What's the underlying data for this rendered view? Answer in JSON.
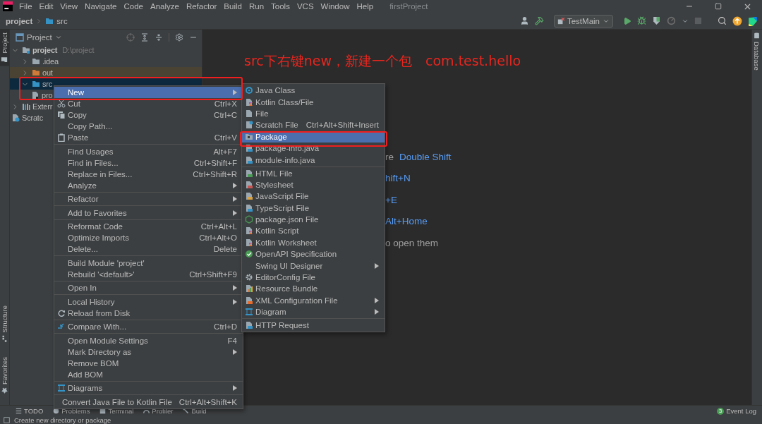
{
  "menu_bar": {
    "items": [
      "File",
      "Edit",
      "View",
      "Navigate",
      "Code",
      "Analyze",
      "Refactor",
      "Build",
      "Run",
      "Tools",
      "VCS",
      "Window",
      "Help"
    ],
    "project_title": "firstProject"
  },
  "breadcrumbs": [
    "project",
    "src"
  ],
  "run_config": {
    "label": "TestMain"
  },
  "left_strip": [
    {
      "label": "Project",
      "selected": true
    },
    {
      "label": "Structure",
      "selected": false
    },
    {
      "label": "Favorites",
      "selected": false
    }
  ],
  "right_strip": [
    {
      "label": "Database",
      "selected": false
    }
  ],
  "project_panel": {
    "title": "Project",
    "tree": [
      {
        "label": "project",
        "path": "D:\\project",
        "kind": "module",
        "expanded": true,
        "selected": false,
        "children": [
          {
            "label": ".idea",
            "kind": "folder",
            "expanded": false,
            "selected": false
          },
          {
            "label": "out",
            "kind": "excluded-folder",
            "expanded": false,
            "selected": false
          },
          {
            "label": "src",
            "kind": "source-folder",
            "expanded": true,
            "selected": true,
            "children": [
              {
                "label": "pro",
                "kind": "file",
                "selected": false
              }
            ]
          }
        ]
      },
      {
        "label": "Exterr",
        "kind": "libraries",
        "expanded": false,
        "selected": false
      },
      {
        "label": "Scratc",
        "kind": "scratches",
        "selected": false
      }
    ]
  },
  "editor": {
    "annotation": "src下右键new，新建一个包　com.test.hello",
    "hints": [
      [
        {
          "text": "re",
          "key": false
        },
        {
          "text": "Double Shift",
          "key": true
        }
      ],
      [
        {
          "text": "hift+N",
          "key": true
        }
      ],
      [
        {
          "text": "+E",
          "key": true
        }
      ],
      [
        {
          "text": "Alt+Home",
          "key": true
        }
      ],
      [
        {
          "text": "o open them",
          "key": false
        }
      ]
    ]
  },
  "context_menu": {
    "groups": [
      [
        {
          "label": "New",
          "submenu": true,
          "selected": true
        },
        {
          "label": "Cut",
          "shortcut": "Ctrl+X",
          "selected": false
        },
        {
          "label": "Copy",
          "shortcut": "Ctrl+C",
          "selected": false
        },
        {
          "label": "Copy Path...",
          "selected": false
        },
        {
          "label": "Paste",
          "shortcut": "Ctrl+V",
          "selected": false
        }
      ],
      [
        {
          "label": "Find Usages",
          "shortcut": "Alt+F7",
          "selected": false
        },
        {
          "label": "Find in Files...",
          "shortcut": "Ctrl+Shift+F",
          "selected": false
        },
        {
          "label": "Replace in Files...",
          "shortcut": "Ctrl+Shift+R",
          "selected": false
        },
        {
          "label": "Analyze",
          "submenu": true,
          "selected": false
        }
      ],
      [
        {
          "label": "Refactor",
          "submenu": true,
          "selected": false
        }
      ],
      [
        {
          "label": "Add to Favorites",
          "submenu": true,
          "selected": false
        }
      ],
      [
        {
          "label": "Reformat Code",
          "shortcut": "Ctrl+Alt+L",
          "selected": false
        },
        {
          "label": "Optimize Imports",
          "shortcut": "Ctrl+Alt+O",
          "selected": false
        },
        {
          "label": "Delete...",
          "shortcut": "Delete",
          "selected": false
        }
      ],
      [
        {
          "label": "Build Module 'project'",
          "selected": false
        },
        {
          "label": "Rebuild '<default>'",
          "shortcut": "Ctrl+Shift+F9",
          "selected": false
        }
      ],
      [
        {
          "label": "Open In",
          "submenu": true,
          "selected": false
        }
      ],
      [
        {
          "label": "Local History",
          "submenu": true,
          "selected": false
        },
        {
          "label": "Reload from Disk",
          "selected": false
        }
      ],
      [
        {
          "label": "Compare With...",
          "shortcut": "Ctrl+D",
          "selected": false
        }
      ],
      [
        {
          "label": "Open Module Settings",
          "shortcut": "F4",
          "selected": false
        },
        {
          "label": "Mark Directory as",
          "submenu": true,
          "selected": false
        },
        {
          "label": "Remove BOM",
          "selected": false
        },
        {
          "label": "Add BOM",
          "selected": false
        }
      ],
      [
        {
          "label": "Diagrams",
          "submenu": true,
          "selected": false
        }
      ],
      [
        {
          "label": "Convert Java File to Kotlin File",
          "shortcut": "Ctrl+Alt+Shift+K",
          "selected": false
        }
      ]
    ]
  },
  "new_submenu": {
    "groups": [
      [
        {
          "label": "Java Class",
          "selected": false
        },
        {
          "label": "Kotlin Class/File",
          "selected": false
        },
        {
          "label": "File",
          "selected": false
        },
        {
          "label": "Scratch File",
          "shortcut": "Ctrl+Alt+Shift+Insert",
          "selected": false
        },
        {
          "label": "Package",
          "selected": true
        },
        {
          "label": "package-info.java",
          "selected": false
        },
        {
          "label": "module-info.java",
          "selected": false
        }
      ],
      [
        {
          "label": "HTML File",
          "selected": false
        },
        {
          "label": "Stylesheet",
          "selected": false
        },
        {
          "label": "JavaScript File",
          "selected": false
        },
        {
          "label": "TypeScript File",
          "selected": false
        },
        {
          "label": "package.json File",
          "selected": false
        },
        {
          "label": "Kotlin Script",
          "selected": false
        },
        {
          "label": "Kotlin Worksheet",
          "selected": false
        },
        {
          "label": "OpenAPI Specification",
          "selected": false
        },
        {
          "label": "Swing UI Designer",
          "submenu": true,
          "selected": false
        },
        {
          "label": "EditorConfig File",
          "selected": false
        },
        {
          "label": "Resource Bundle",
          "selected": false
        },
        {
          "label": "XML Configuration File",
          "submenu": true,
          "selected": false
        },
        {
          "label": "Diagram",
          "submenu": true,
          "selected": false
        }
      ],
      [
        {
          "label": "HTTP Request",
          "selected": false
        }
      ]
    ]
  },
  "bottom_bar": {
    "tools": [
      "TODO",
      "Problems",
      "Terminal",
      "Profiler",
      "Build"
    ],
    "event_log": {
      "label": "Event Log",
      "count": "3"
    }
  },
  "status_bar": {
    "message": "Create new directory or package"
  }
}
